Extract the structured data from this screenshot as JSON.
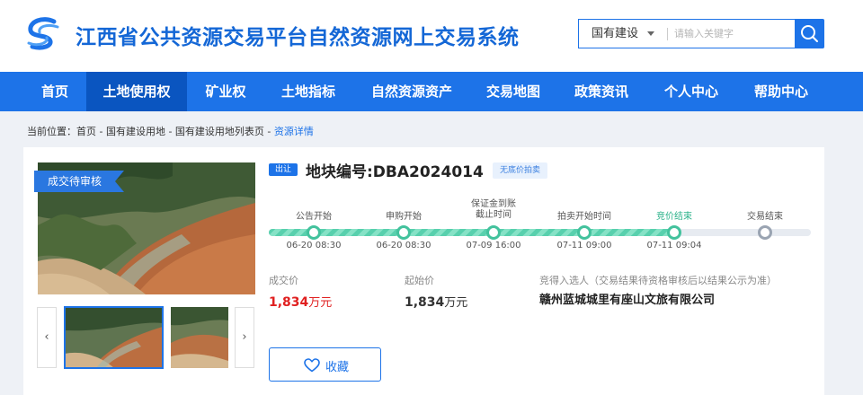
{
  "header": {
    "title": "江西省公共资源交易平台自然资源网上交易系统",
    "search_category": "国有建设",
    "search_placeholder": "请输入关键字"
  },
  "nav": {
    "items": [
      {
        "label": "首页"
      },
      {
        "label": "土地使用权"
      },
      {
        "label": "矿业权"
      },
      {
        "label": "土地指标"
      },
      {
        "label": "自然资源资产"
      },
      {
        "label": "交易地图"
      },
      {
        "label": "政策资讯"
      },
      {
        "label": "个人中心"
      },
      {
        "label": "帮助中心"
      }
    ],
    "active": "土地使用权"
  },
  "breadcrumb": {
    "prefix": "当前位置：",
    "path": "首页 - 国有建设用地 - 国有建设用地列表页 - ",
    "current": "资源详情"
  },
  "listing": {
    "status_flag": "成交待审核",
    "sale_tag": "出让",
    "lot_title": "地块编号:DBA2024014",
    "reserve_tag": "无底价拍卖",
    "timeline": [
      {
        "label": "公告开始",
        "time": "06-20 08:30"
      },
      {
        "label": "申购开始",
        "time": "06-20 08:30"
      },
      {
        "label": "保证金到账\n截止时间",
        "time": "07-09 16:00"
      },
      {
        "label": "拍卖开始时间",
        "time": "07-11 09:00"
      },
      {
        "label": "竞价结束",
        "time": "07-11 09:04"
      },
      {
        "label": "交易结束",
        "time": ""
      }
    ],
    "current_step": "竞价结束",
    "deal_price_label": "成交价",
    "deal_price_value": "1,834",
    "deal_price_unit": "万元",
    "start_price_label": "起始价",
    "start_price_value": "1,834",
    "start_price_unit": "万元",
    "winner_label": "竞得入选人（交易结果待资格审核后以结果公示为准）",
    "winner_name": "赣州蓝城城里有座山文旅有限公司",
    "favorite_label": "收藏"
  },
  "colors": {
    "brand": "#1d73e8",
    "nav_active": "#0a55c0",
    "progress": "#58d0ad",
    "deal_price": "#e02020"
  },
  "icons": [
    "logo-icon",
    "search-icon",
    "chevron-down-icon",
    "chevron-left-icon",
    "chevron-right-icon",
    "heart-icon"
  ]
}
